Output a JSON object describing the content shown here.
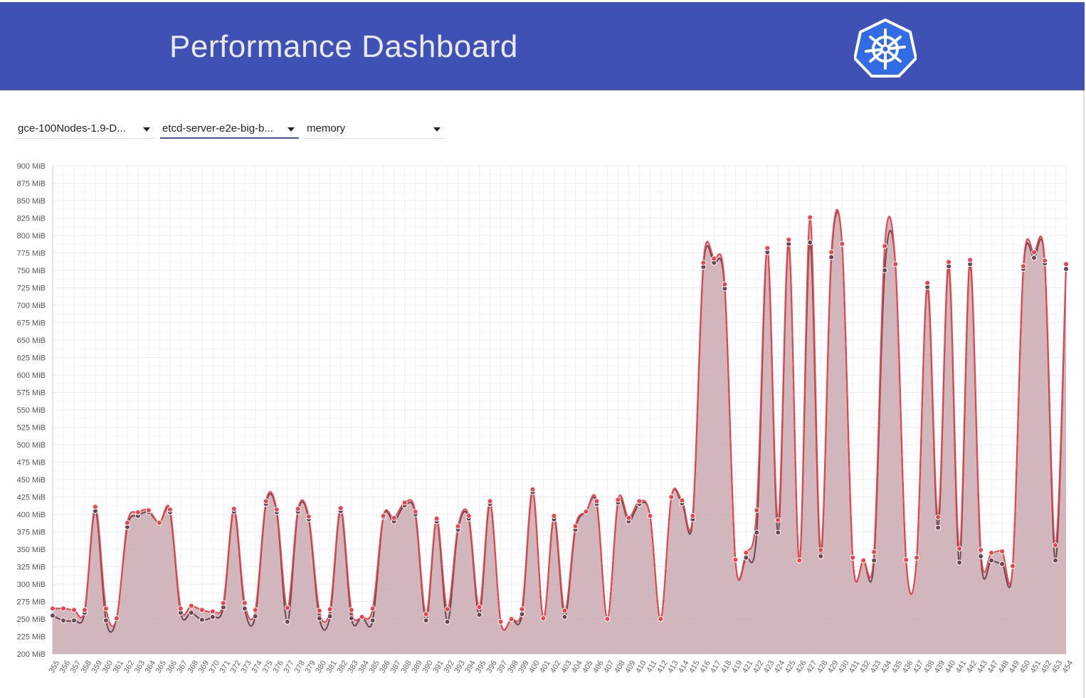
{
  "header": {
    "title": "Performance Dashboard",
    "logo_icon": "kubernetes-helm-wheel-logo"
  },
  "selectors": [
    {
      "value": "gce-100Nodes-1.9-D...",
      "active": false
    },
    {
      "value": "etcd-server-e2e-big-b...",
      "active": true
    },
    {
      "value": "memory",
      "active": false
    }
  ],
  "colors": {
    "header": "#3f51b5",
    "series_top": "#f0404a",
    "series_bottom": "#6b4550",
    "area": "#cfb2b8"
  },
  "chart_data": {
    "type": "area",
    "ylim": [
      200,
      900
    ],
    "yunit": "MiB",
    "yticks": [
      200,
      225,
      250,
      275,
      300,
      325,
      350,
      375,
      400,
      425,
      450,
      475,
      500,
      525,
      550,
      575,
      600,
      625,
      650,
      675,
      700,
      725,
      750,
      775,
      800,
      825,
      850,
      875,
      900
    ],
    "ytick_labels": [
      "200 MiB",
      "225 MiB",
      "250 MiB",
      "275 MiB",
      "300 MiB",
      "325 MiB",
      "350 MiB",
      "375 MiB",
      "400 MiB",
      "425 MiB",
      "450 MiB",
      "475 MiB",
      "500 MiB",
      "525 MiB",
      "550 MiB",
      "575 MiB",
      "600 MiB",
      "625 MiB",
      "650 MiB",
      "675 MiB",
      "700 MiB",
      "725 MiB",
      "750 MiB",
      "775 MiB",
      "800 MiB",
      "825 MiB",
      "850 MiB",
      "875 MiB",
      "900 MiB"
    ],
    "grid": true,
    "categories": [
      "355",
      "356",
      "357",
      "358",
      "359",
      "360",
      "361",
      "362",
      "363",
      "364",
      "365",
      "366",
      "367",
      "368",
      "369",
      "370",
      "371",
      "372",
      "373",
      "374",
      "375",
      "376",
      "377",
      "378",
      "379",
      "380",
      "381",
      "382",
      "383",
      "384",
      "385",
      "386",
      "387",
      "388",
      "389",
      "390",
      "391",
      "392",
      "393",
      "394",
      "395",
      "396",
      "397",
      "398",
      "399",
      "400",
      "401",
      "402",
      "403",
      "404",
      "405",
      "406",
      "407",
      "408",
      "409",
      "410",
      "411",
      "412",
      "413",
      "414",
      "415",
      "416",
      "417",
      "418",
      "419",
      "421",
      "422",
      "423",
      "424",
      "425",
      "426",
      "427",
      "428",
      "429",
      "430",
      "431",
      "432",
      "433",
      "434",
      "435",
      "436",
      "437",
      "438",
      "439",
      "440",
      "441",
      "442",
      "443",
      "447",
      "448",
      "449",
      "450",
      "451",
      "452",
      "453",
      "454"
    ],
    "series": [
      {
        "values": [
          265,
          265,
          263,
          263,
          411,
          265,
          251,
          388,
          403,
          406,
          388,
          407,
          265,
          269,
          263,
          261,
          273,
          408,
          273,
          263,
          419,
          407,
          266,
          408,
          397,
          262,
          264,
          409,
          263,
          253,
          265,
          398,
          395,
          417,
          404,
          257,
          394,
          264,
          383,
          398,
          267,
          419,
          246,
          250,
          264,
          436,
          251,
          398,
          262,
          383,
          404,
          419,
          250,
          421,
          395,
          419,
          398,
          250,
          425,
          420,
          398,
          761,
          767,
          730,
          335,
          345,
          406,
          782,
          392,
          794,
          334,
          826,
          349,
          776,
          788,
          338,
          334,
          346,
          785,
          759,
          335,
          338,
          732,
          396,
          762,
          351,
          765,
          349,
          345,
          347,
          326,
          756,
          776,
          764,
          356,
          759
        ]
      },
      {
        "values": [
          255,
          248,
          248,
          259,
          405,
          248,
          251,
          382,
          398,
          403,
          388,
          403,
          259,
          259,
          249,
          253,
          267,
          404,
          265,
          254,
          415,
          403,
          246,
          404,
          393,
          251,
          254,
          405,
          251,
          253,
          248,
          396,
          390,
          413,
          400,
          248,
          390,
          246,
          378,
          394,
          256,
          415,
          246,
          250,
          257,
          432,
          251,
          393,
          253,
          378,
          404,
          415,
          250,
          417,
          390,
          415,
          398,
          250,
          425,
          416,
          393,
          755,
          761,
          724,
          335,
          338,
          374,
          776,
          374,
          788,
          334,
          790,
          340,
          769,
          788,
          338,
          334,
          334,
          750,
          759,
          335,
          338,
          726,
          381,
          756,
          331,
          759,
          340,
          334,
          329,
          326,
          752,
          768,
          760,
          334,
          752
        ]
      }
    ]
  }
}
